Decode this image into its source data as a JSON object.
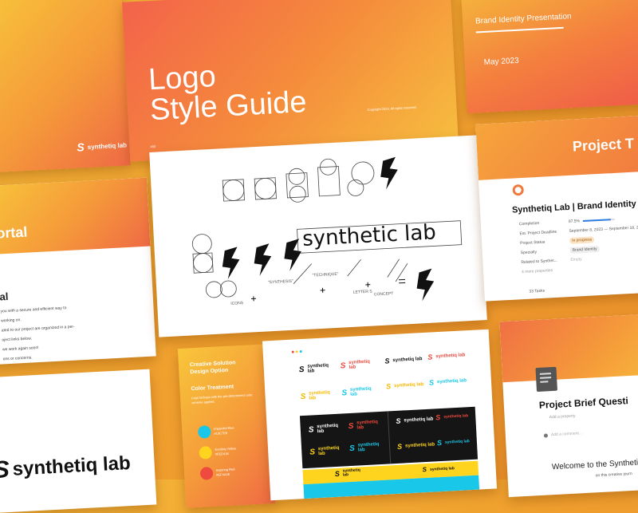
{
  "cover": {
    "title_line1": "Logo",
    "title_line2": "Style Guide",
    "copyright": "Copyright 2023. All rights reserved.",
    "page_label": "#00"
  },
  "brand": {
    "name": "synthetiq lab",
    "short_top": "synthetiq",
    "short_bottom": "lab",
    "sketch_text": "synthetic lab",
    "notes": [
      "ICONS",
      "\"SYNTHESIS\"",
      "\"TECHNIQUE\"",
      "LETTER S",
      "CONCEPT"
    ]
  },
  "presentation": {
    "title": "Brand Identity Presentation",
    "date": "May 2023"
  },
  "portal": {
    "title_fragment": "ortal",
    "sub_fragment": "al",
    "lines": [
      "you with a secure and efficient way to",
      "working on.",
      "ated to our project are organized in a per-",
      "oject links below.",
      "we work again soon!",
      "ons or concerns."
    ]
  },
  "project": {
    "header": "Project T",
    "name": "Synthetiq Lab | Brand Identity D",
    "props": [
      {
        "label": "Completion",
        "value": "87.5%"
      },
      {
        "label": "Est. Project Deadline",
        "value": "September 8, 2023 — September 18, 2023"
      },
      {
        "label": "Project Status",
        "value": "In progress"
      },
      {
        "label": "Specialty",
        "value": "Brand Identity"
      },
      {
        "label": "Related to Synthet...",
        "value": "Empty"
      },
      {
        "label": "4 more properties",
        "value": ""
      }
    ],
    "tasks": "33 Tasks"
  },
  "color": {
    "title_line1": "Creative Solution",
    "title_line2": "Design Option",
    "section": "Color Treatment",
    "desc": "Logo lockups with the pre-determined color scheme applied.",
    "swatches": [
      {
        "name": "Impactful Blue",
        "hex": "#19C7E8"
      },
      {
        "name": "Exciting Yellow",
        "hex": "#FED41E"
      },
      {
        "name": "Inspiring Red",
        "hex": "#EF4A3E"
      }
    ]
  },
  "questionnaire": {
    "title": "Project Brief Questi",
    "add_property": "Add a property",
    "add_comment": "Add a comment...",
    "welcome": "Welcome to the Syntheti",
    "welcome_sub": "on this creative journ"
  },
  "colors": {
    "blue": "#19c7e8",
    "yellow": "#fed41e",
    "red": "#ef4a3e",
    "dark": "#151515"
  }
}
